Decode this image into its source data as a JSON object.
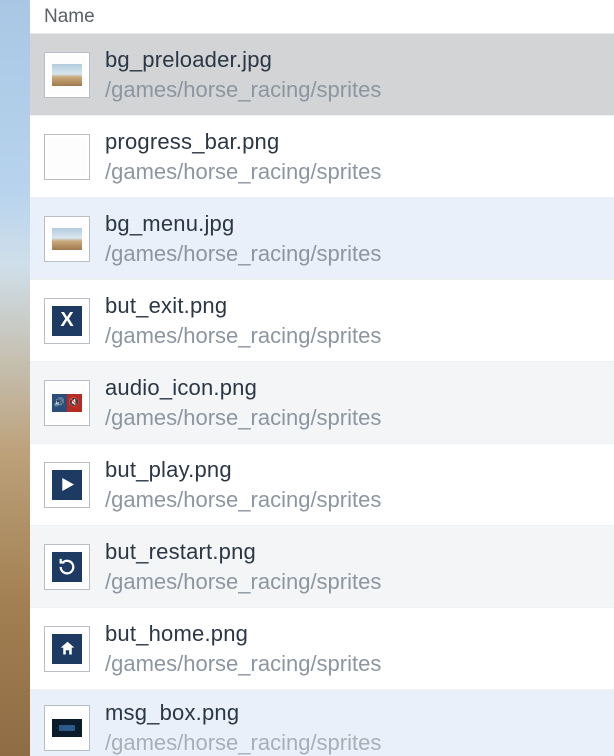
{
  "header": {
    "column_label": "Name"
  },
  "files": [
    {
      "name": "bg_preloader.jpg",
      "path": "/games/horse_racing/sprites",
      "icon": "scene",
      "state": "selected"
    },
    {
      "name": "progress_bar.png",
      "path": "/games/horse_racing/sprites",
      "icon": "blank",
      "state": ""
    },
    {
      "name": "bg_menu.jpg",
      "path": "/games/horse_racing/sprites",
      "icon": "scene",
      "state": "highlight"
    },
    {
      "name": "but_exit.png",
      "path": "/games/horse_racing/sprites",
      "icon": "x",
      "state": ""
    },
    {
      "name": "audio_icon.png",
      "path": "/games/horse_racing/sprites",
      "icon": "audio",
      "state": "alt"
    },
    {
      "name": "but_play.png",
      "path": "/games/horse_racing/sprites",
      "icon": "play",
      "state": ""
    },
    {
      "name": "but_restart.png",
      "path": "/games/horse_racing/sprites",
      "icon": "restart",
      "state": "alt"
    },
    {
      "name": "but_home.png",
      "path": "/games/horse_racing/sprites",
      "icon": "home",
      "state": ""
    },
    {
      "name": "msg_box.png",
      "path": "/games/horse_racing/sprites",
      "icon": "msg",
      "state": "highlight"
    }
  ]
}
